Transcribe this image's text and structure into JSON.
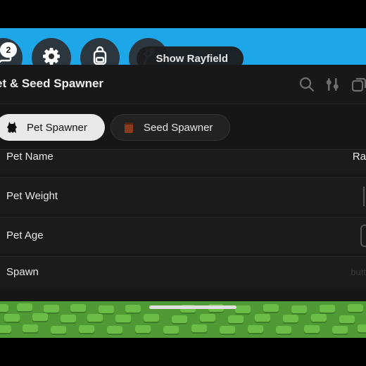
{
  "topbar": {
    "notification_count": "2",
    "buttons": [
      {
        "icon": "chat-icon"
      },
      {
        "icon": "gear-icon"
      },
      {
        "icon": "backpack-icon"
      },
      {
        "icon": "emote-icon"
      }
    ],
    "show_rayfield_label": "Show Rayfield"
  },
  "window": {
    "title": "et & Seed Spawner",
    "toolbar_icons": [
      "search-icon",
      "settings-sliders-icon",
      "window-icon"
    ],
    "tabs": [
      {
        "label": "Pet Spawner",
        "active": true,
        "icon": "pet-icon"
      },
      {
        "label": "Seed Spawner",
        "active": false,
        "icon": "seed-pack-icon"
      }
    ],
    "rows": [
      {
        "label": "Pet Name",
        "right_text": "Ra"
      },
      {
        "label": "Pet Weight"
      },
      {
        "label": "Pet Age"
      },
      {
        "label": "Spawn",
        "right_text": "butt"
      }
    ]
  },
  "colors": {
    "sky": "#1ea7e8",
    "panel": "#161616",
    "row": "#1b1b1b",
    "active_tab": "#e9e9e9",
    "ground": "#4f9a35"
  }
}
